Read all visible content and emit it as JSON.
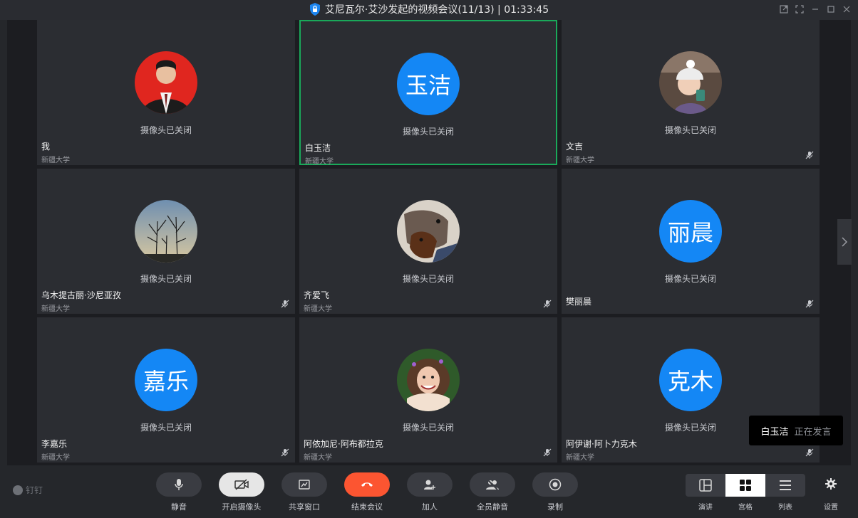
{
  "window": {
    "title": "艾尼瓦尔·艾沙发起的视频会议(11/13) | 01:33:45"
  },
  "tiles": [
    {
      "name": "我",
      "org": "新疆大学",
      "camera": "摄像头已关闭",
      "avatar_type": "photo",
      "avatar_desc": "man-suit-red-bg",
      "muted": false,
      "active": false
    },
    {
      "name": "白玉洁",
      "org": "新疆大学",
      "camera": "摄像头已关闭",
      "avatar_type": "text",
      "avatar_text": "玉洁",
      "muted": false,
      "active": true
    },
    {
      "name": "文吉",
      "org": "新疆大学",
      "camera": "摄像头已关闭",
      "avatar_type": "photo",
      "avatar_desc": "child-winter-hat",
      "muted": true,
      "active": false
    },
    {
      "name": "乌木提古丽·沙尼亚孜",
      "org": "新疆大学",
      "camera": "摄像头已关闭",
      "avatar_type": "photo",
      "avatar_desc": "trees-sky",
      "muted": true,
      "active": false
    },
    {
      "name": "齐爱飞",
      "org": "新疆大学",
      "camera": "摄像头已关闭",
      "avatar_type": "photo",
      "avatar_desc": "dogs",
      "muted": true,
      "active": false
    },
    {
      "name": "樊丽晨",
      "org": "",
      "camera": "摄像头已关闭",
      "avatar_type": "text",
      "avatar_text": "丽晨",
      "muted": true,
      "active": false
    },
    {
      "name": "李嘉乐",
      "org": "新疆大学",
      "camera": "摄像头已关闭",
      "avatar_type": "text",
      "avatar_text": "嘉乐",
      "muted": true,
      "active": false
    },
    {
      "name": "阿依加尼·阿布都拉克",
      "org": "新疆大学",
      "camera": "摄像头已关闭",
      "avatar_type": "photo",
      "avatar_desc": "girl-grass",
      "muted": true,
      "active": false
    },
    {
      "name": "阿伊谢·阿卜力克木",
      "org": "新疆大学",
      "camera": "摄像头已关闭",
      "avatar_type": "text",
      "avatar_text": "克木",
      "muted": true,
      "active": false
    }
  ],
  "speaker_toast": {
    "name": "白玉洁",
    "status": "正在发言"
  },
  "toolbar": {
    "brand": "钉钉",
    "buttons": [
      {
        "label": "静音",
        "icon": "microphone-icon"
      },
      {
        "label": "开启摄像头",
        "icon": "camera-off-icon"
      },
      {
        "label": "共享窗口",
        "icon": "share-window-icon"
      },
      {
        "label": "结束会议",
        "icon": "hang-up-icon"
      },
      {
        "label": "加人",
        "icon": "add-person-icon"
      },
      {
        "label": "全员静音",
        "icon": "mute-all-icon"
      },
      {
        "label": "录制",
        "icon": "record-icon"
      }
    ],
    "views": [
      {
        "label": "演讲",
        "icon": "speaker-layout-icon",
        "selected": false
      },
      {
        "label": "宫格",
        "icon": "grid-layout-icon",
        "selected": true
      },
      {
        "label": "列表",
        "icon": "list-layout-icon",
        "selected": false
      }
    ],
    "settings_label": "设置"
  },
  "colors": {
    "active_border": "#1aa95a",
    "avatar_blue": "#1487f5",
    "end_call_red": "#fc5531"
  }
}
